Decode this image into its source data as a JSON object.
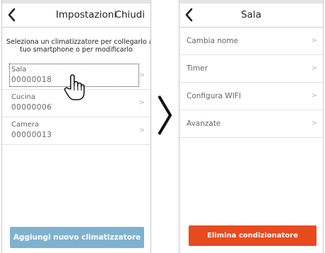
{
  "left_screen": {
    "title": "Impostazioni",
    "action": "Chiudi",
    "instruction_line1": "Seleziona un climatizzatore per collegarlo al",
    "instruction_line2": "tuo smartphone o per modificarlo",
    "devices": [
      {
        "name": "Sala",
        "code": "00000018",
        "selected": true
      },
      {
        "name": "Cucina",
        "code": "00000006",
        "selected": false
      },
      {
        "name": "Camera",
        "code": "00000013",
        "selected": false
      }
    ],
    "add_button_label": "Aggiungi nuovo climatizzatore"
  },
  "right_screen": {
    "title": "Sala",
    "menu_items": [
      "Cambia nome",
      "Timer",
      "Configura WIFI",
      "Avanzate"
    ],
    "delete_button_label": "Elimina condizionatore"
  },
  "colors": {
    "add_button": "#7fb2cf",
    "delete_button": "#e84a1f"
  },
  "icons": {
    "back": "chevron-left-icon",
    "row": "chevron-right-icon",
    "pointer": "hand-pointer-icon",
    "transition": "chevron-right-large-icon"
  }
}
